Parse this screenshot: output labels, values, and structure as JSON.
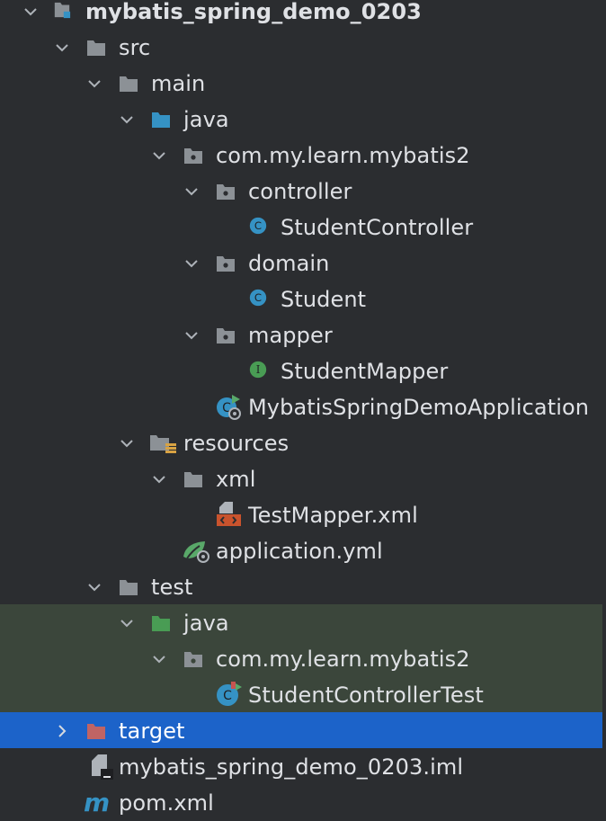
{
  "tree": {
    "project": {
      "name": "mybatis_spring_demo_0203"
    },
    "src": "src",
    "main": "main",
    "main_java": "java",
    "main_package": "com.my.learn.mybatis2",
    "controller_pkg": "controller",
    "controller_class": "StudentController",
    "domain_pkg": "domain",
    "domain_class": "Student",
    "mapper_pkg": "mapper",
    "mapper_interface": "StudentMapper",
    "application_class": "MybatisSpringDemoApplication",
    "resources": "resources",
    "xml_folder": "xml",
    "xml_file": "TestMapper.xml",
    "yml_file": "application.yml",
    "test": "test",
    "test_java": "java",
    "test_package": "com.my.learn.mybatis2",
    "test_class": "StudentControllerTest",
    "target": "target",
    "iml_file": "mybatis_spring_demo_0203.iml",
    "pom_file": "pom.xml"
  },
  "colors": {
    "background": "#2b2d30",
    "test_sources_highlight": "#3b463b",
    "selection": "#1c63c9",
    "folder_gray": "#8c9196",
    "source_root": "#3592c4",
    "test_root": "#499c54",
    "excluded_folder": "#c06464",
    "class_badge": "#3592c4",
    "interface_badge": "#499c54",
    "text": "#dfe1e5"
  },
  "icons": {
    "chevron_expanded": "chevron-down-icon",
    "chevron_collapsed": "chevron-right-icon",
    "module": "module-icon",
    "folder": "folder-icon",
    "package": "package-icon",
    "class": "class-icon",
    "interface": "interface-icon",
    "spring_boot_app": "spring-boot-app-icon",
    "resources_folder": "resources-folder-icon",
    "xml_file": "xml-file-icon",
    "yaml_file": "spring-yaml-icon",
    "test_class": "test-class-icon",
    "iml_file": "iml-file-icon",
    "maven_file": "maven-icon"
  }
}
